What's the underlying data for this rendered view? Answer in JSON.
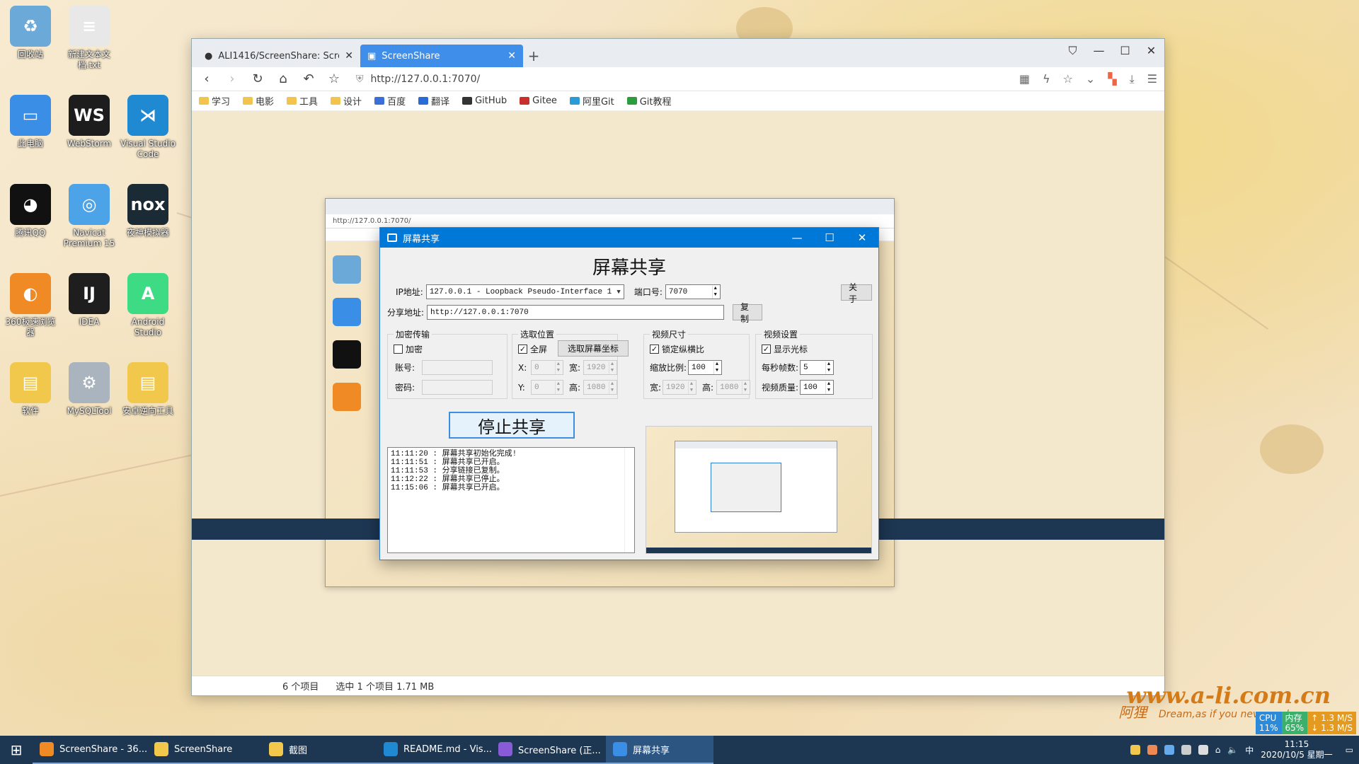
{
  "desktop": {
    "icons": [
      {
        "label": "回收站",
        "color": "#6aa9d8",
        "glyph": "♻"
      },
      {
        "label": "新建文本文档.txt",
        "color": "#e8e8e8",
        "glyph": "≡"
      },
      {
        "label": "此电脑",
        "color": "#3a8ee6",
        "glyph": "▭"
      },
      {
        "label": "WebStorm",
        "color": "#1d1d1d",
        "glyph": "WS"
      },
      {
        "label": "Visual Studio Code",
        "color": "#1f8ad2",
        "glyph": "⋊"
      },
      {
        "label": "腾讯QQ",
        "color": "#111111",
        "glyph": "◕"
      },
      {
        "label": "Navicat Premium 15",
        "color": "#4da3e8",
        "glyph": "◎"
      },
      {
        "label": "夜神模拟器",
        "color": "#1b2b36",
        "glyph": "nox"
      },
      {
        "label": "360极速浏览器",
        "color": "#f08a24",
        "glyph": "◐"
      },
      {
        "label": "IDEA",
        "color": "#1e1e1e",
        "glyph": "IJ"
      },
      {
        "label": "Android Studio",
        "color": "#3ddc84",
        "glyph": "A"
      },
      {
        "label": "软件",
        "color": "#f2c84c",
        "glyph": "▤"
      },
      {
        "label": "MySQLTool",
        "color": "#aab4be",
        "glyph": "⚙"
      },
      {
        "label": "安卓逆向工具",
        "color": "#f2c84c",
        "glyph": "▤"
      }
    ]
  },
  "browser": {
    "tabs": [
      {
        "title": "ALI1416/ScreenShare: Screen...",
        "icon": "github-icon"
      },
      {
        "title": "ScreenShare",
        "icon": "screen-icon"
      }
    ],
    "url": "http://127.0.0.1:7070/",
    "bookmarks": [
      "学习",
      "电影",
      "工具",
      "设计",
      "百度",
      "翻译",
      "GitHub",
      "Gitee",
      "阿里Git",
      "Git教程"
    ]
  },
  "app": {
    "window_title": "屏幕共享",
    "heading": "屏幕共享",
    "ip_label": "IP地址:",
    "ip_value": "127.0.0.1 - Loopback Pseudo-Interface 1",
    "port_label": "端口号:",
    "port_value": "7070",
    "about_button": "关于",
    "share_label": "分享地址:",
    "share_value": "http://127.0.0.1:7070",
    "copy_button": "复制",
    "encrypt": {
      "title": "加密传输",
      "checkbox_label": "加密",
      "checked": false,
      "account_label": "账号:",
      "password_label": "密码:"
    },
    "position": {
      "title": "选取位置",
      "fullscreen_label": "全屏",
      "fullscreen_checked": true,
      "pick_button": "选取屏幕坐标",
      "x_label": "X:",
      "x_value": "0",
      "y_label": "Y:",
      "y_value": "0",
      "width_label": "宽:",
      "width_value": "1920",
      "height_label": "高:",
      "height_value": "1080"
    },
    "video_size": {
      "title": "视频尺寸",
      "lock_label": "锁定纵横比",
      "lock_checked": true,
      "scale_label": "缩放比例:",
      "scale_value": "100",
      "width_label": "宽:",
      "width_value": "1920",
      "height_label": "高:",
      "height_value": "1080"
    },
    "video_settings": {
      "title": "视频设置",
      "cursor_label": "显示光标",
      "cursor_checked": true,
      "fps_label": "每秒帧数:",
      "fps_value": "5",
      "quality_label": "视频质量:",
      "quality_value": "100"
    },
    "stop_button": "停止共享",
    "log_lines": [
      "11:11:20 : 屏幕共享初始化完成!",
      "11:11:51 : 屏幕共享已开启。",
      "11:11:53 : 分享链接已复制。",
      "11:12:22 : 屏幕共享已停止。",
      "11:15:06 : 屏幕共享已开启。"
    ]
  },
  "explorer_status": {
    "items": "6 个项目",
    "selected": "选中 1 个项目  1.71 MB"
  },
  "taskbar": {
    "items": [
      {
        "label": "ScreenShare - 36...",
        "color": "#f08a24",
        "active": false
      },
      {
        "label": "ScreenShare",
        "color": "#f2c84c",
        "active": false
      },
      {
        "label": "截图",
        "color": "#f2c84c",
        "active": false
      },
      {
        "label": "README.md - Vis...",
        "color": "#1f8ad2",
        "active": false
      },
      {
        "label": "ScreenShare (正...",
        "color": "#8a5bd6",
        "active": false
      },
      {
        "label": "屏幕共享",
        "color": "#3a8ee6",
        "active": true
      }
    ],
    "ime": "中",
    "time": "11:15",
    "date": "2020/10/5 星期一"
  },
  "net_monitor": {
    "cpu_label": "CPU",
    "cpu_value": "11%",
    "mem_label": "内存",
    "mem_value": "65%",
    "up": "1.3 M/S",
    "down": "1.3 M/S"
  },
  "wallpaper": {
    "watermark": "www.a-li.com.cn",
    "sub_logo": "阿狸",
    "tagline": "Dream,as if you never wake up"
  }
}
